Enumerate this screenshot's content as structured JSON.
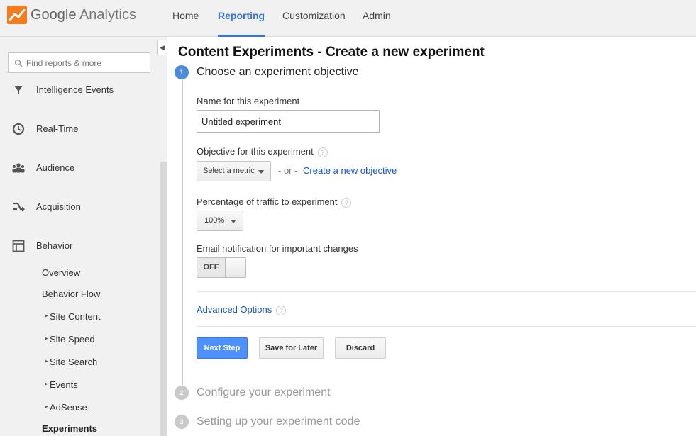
{
  "app": {
    "brand_google": "Google",
    "brand_analytics": "Analytics"
  },
  "nav": {
    "items": [
      "Home",
      "Reporting",
      "Customization",
      "Admin"
    ],
    "active": "Reporting"
  },
  "sidebar": {
    "search_placeholder": "Find reports & more",
    "items": [
      "Intelligence Events",
      "Real-Time",
      "Audience",
      "Acquisition",
      "Behavior"
    ],
    "behavior_sub": [
      "Overview",
      "Behavior Flow",
      "Site Content",
      "Site Speed",
      "Site Search",
      "Events",
      "AdSense",
      "Experiments"
    ]
  },
  "page": {
    "title": "Content Experiments - Create a new experiment"
  },
  "steps": [
    {
      "number": "1",
      "title": "Choose an experiment objective"
    },
    {
      "number": "2",
      "title": "Configure your experiment"
    },
    {
      "number": "3",
      "title": "Setting up your experiment code"
    }
  ],
  "form": {
    "name_label": "Name for this experiment",
    "name_value": "Untitled experiment",
    "objective_label": "Objective for this experiment",
    "metric_select": "Select a metric",
    "or_text": "- or -",
    "create_objective_link": "Create a new objective",
    "traffic_label": "Percentage of traffic to experiment",
    "traffic_value": "100%",
    "email_label": "Email notification for important changes",
    "toggle_state": "OFF",
    "advanced_link": "Advanced Options",
    "help_glyph": "?"
  },
  "buttons": {
    "next": "Next Step",
    "save": "Save for Later",
    "discard": "Discard"
  },
  "colors": {
    "accent": "#3a73d8",
    "primary_button": "#4d90fe",
    "link": "#1155cc"
  }
}
